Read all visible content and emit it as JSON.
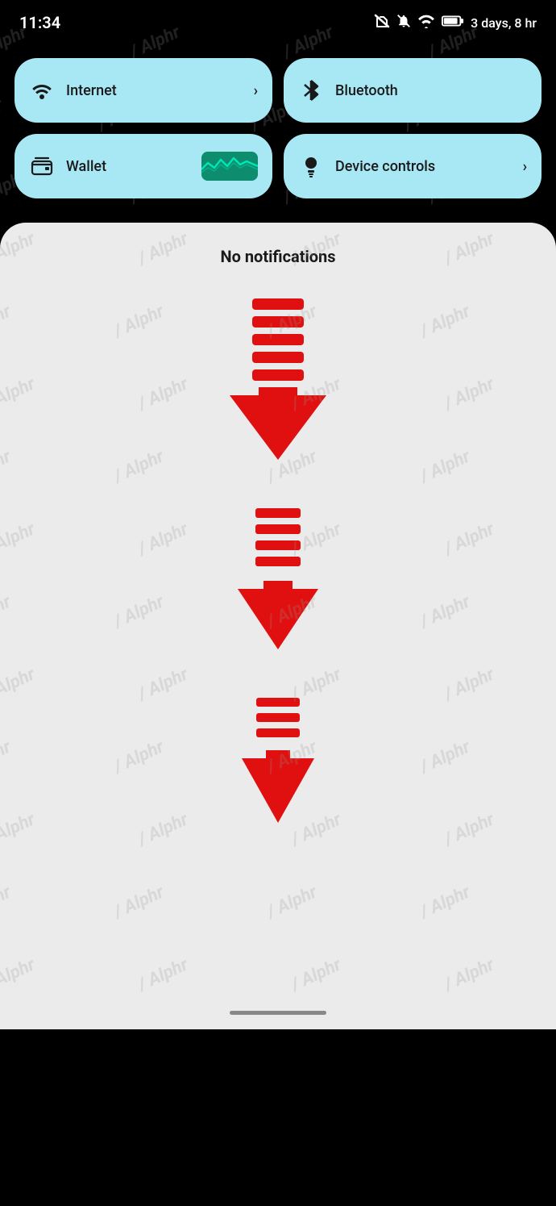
{
  "status_bar": {
    "time": "11:34",
    "battery_text": "3 days, 8 hr"
  },
  "quick_settings": {
    "tiles": [
      {
        "id": "internet",
        "icon": "wifi",
        "label": "Internet",
        "has_chevron": true,
        "chevron": "›"
      },
      {
        "id": "bluetooth",
        "icon": "bluetooth",
        "label": "Bluetooth",
        "has_chevron": false
      },
      {
        "id": "wallet",
        "icon": "wallet",
        "label": "Wallet",
        "has_chevron": false
      },
      {
        "id": "device-controls",
        "icon": "bulb",
        "label": "Device controls",
        "has_chevron": true,
        "chevron": "›"
      }
    ]
  },
  "notification_panel": {
    "no_notifications_text": "No notifications",
    "arrows": [
      {
        "id": "arrow1",
        "lines": 5
      },
      {
        "id": "arrow2",
        "lines": 4
      },
      {
        "id": "arrow3",
        "lines": 3
      }
    ]
  },
  "watermark_text": "Alphr"
}
